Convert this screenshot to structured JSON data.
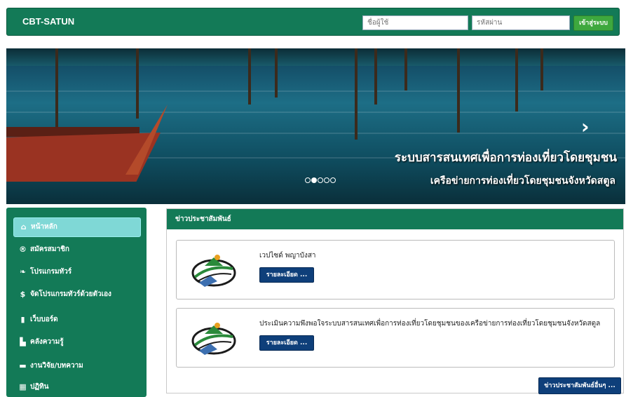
{
  "header": {
    "brand": "CBT-SATUN",
    "username_placeholder": "ชื่อผู้ใช้",
    "password_placeholder": "รหัสผ่าน",
    "login_label": "เข้าสู่ระบบ"
  },
  "banner": {
    "caption_line1": "ระบบสารสนเทศเพื่อการท่องเที่ยวโดยชุมชน",
    "caption_line2": "เครือข่ายการท่องเที่ยวโดยชุมชนจังหวัดสตูล",
    "next_arrow": "›",
    "slides": 5,
    "active_slide": 2
  },
  "sidebar": {
    "items": [
      {
        "label": "หน้าหลัก",
        "icon": "home-icon",
        "glyph": "⌂"
      },
      {
        "label": "สมัครสมาชิก",
        "icon": "register-icon",
        "glyph": "®"
      },
      {
        "label": "โปรแกรมทัวร์",
        "icon": "leaf-icon",
        "glyph": "❧"
      },
      {
        "label": "จัดโปรแกรมทัวร์ด้วยตัวเอง",
        "icon": "dollar-icon",
        "glyph": "$"
      },
      {
        "label": "เว็บบอร์ด",
        "icon": "columns-icon",
        "glyph": "▮"
      },
      {
        "label": "คลังความรู้",
        "icon": "book-icon",
        "glyph": "▙"
      },
      {
        "label": "งานวิจัย/บทความ",
        "icon": "folder-icon",
        "glyph": "▬"
      },
      {
        "label": "ปฏิทิน",
        "icon": "calendar-icon",
        "glyph": "▦"
      }
    ]
  },
  "content": {
    "heading": "ข่าวประชาสัมพันธ์",
    "news": [
      {
        "title": "เวปไซด์ พญาบังสา",
        "button": "รายละเอียด ..."
      },
      {
        "title": "ประเมินความพึงพอใจระบบสารสนเทศเพื่อการท่องเที่ยวโดยชุมชนของเครือข่ายการท่องเที่ยวโดยชุมชนจังหวัดสตูล",
        "button": "รายละเอียด ..."
      }
    ],
    "more_button": "ข่าวประชาสัมพันธ์อื่นๆ ..."
  },
  "colors": {
    "primary": "#137a57",
    "button_dark": "#0e3f7a",
    "login_green": "#3ea83e",
    "active_item": "#7fd8d6"
  }
}
